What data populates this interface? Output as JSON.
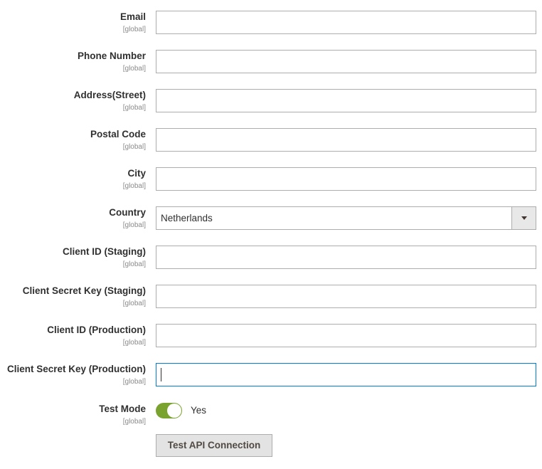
{
  "fields": [
    {
      "label": "Email",
      "scope": "[global]",
      "value": ""
    },
    {
      "label": "Phone Number",
      "scope": "[global]",
      "value": ""
    },
    {
      "label": "Address(Street)",
      "scope": "[global]",
      "value": ""
    },
    {
      "label": "Postal Code",
      "scope": "[global]",
      "value": ""
    },
    {
      "label": "City",
      "scope": "[global]",
      "value": ""
    },
    {
      "label": "Country",
      "scope": "[global]",
      "value": "Netherlands"
    },
    {
      "label": "Client ID (Staging)",
      "scope": "[global]",
      "value": ""
    },
    {
      "label": "Client Secret Key (Staging)",
      "scope": "[global]",
      "value": ""
    },
    {
      "label": "Client ID (Production)",
      "scope": "[global]",
      "value": ""
    },
    {
      "label": "Client Secret Key (Production)",
      "scope": "[global]",
      "value": ""
    },
    {
      "label": "Test Mode",
      "scope": "[global]",
      "value": "Yes"
    }
  ],
  "test_mode": {
    "enabled": true
  },
  "actions": {
    "test_api_label": "Test API Connection"
  },
  "colors": {
    "toggle_on": "#79a22e",
    "focus_border": "#007bdb"
  }
}
